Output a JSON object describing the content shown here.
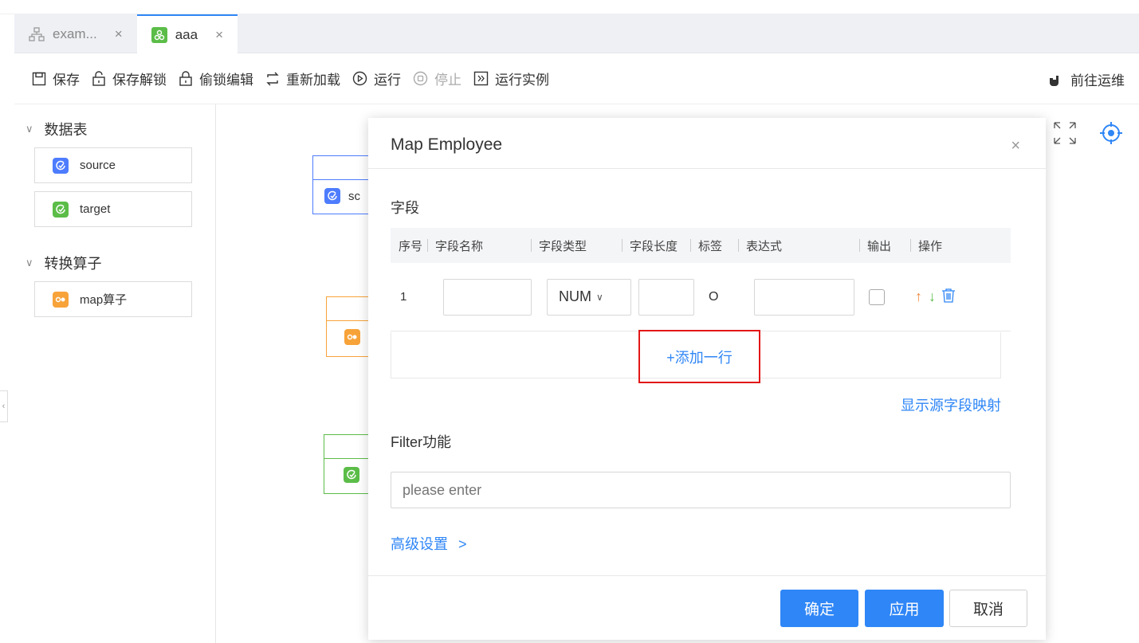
{
  "tabs": [
    {
      "label": "exam...",
      "close": "×",
      "active": false
    },
    {
      "label": "aaa",
      "close": "×",
      "active": true
    }
  ],
  "toolbar": {
    "save": "保存",
    "save_unlock": "保存解锁",
    "steal_lock_edit": "偷锁编辑",
    "reload": "重新加载",
    "run": "运行",
    "stop": "停止",
    "run_instance": "运行实例",
    "goto_ops": "前往运维"
  },
  "sidebar": {
    "section_tables": "数据表",
    "tables": [
      {
        "label": "source",
        "icon": "source-node-icon",
        "color": "#4d7cfe"
      },
      {
        "label": "target",
        "icon": "target-node-icon",
        "color": "#5bbd48"
      }
    ],
    "section_operators": "转换算子",
    "operators": [
      {
        "label": "map算子",
        "icon": "map-operator-icon",
        "color": "#f7a33a"
      }
    ]
  },
  "canvas": {
    "source_node_label": "sc"
  },
  "dialog": {
    "title": "Map Employee",
    "close": "×",
    "fields_label": "字段",
    "columns": [
      "序号",
      "字段名称",
      "字段类型",
      "字段长度",
      "标签",
      "表达式",
      "输出",
      "操作"
    ],
    "rows": [
      {
        "index": "1",
        "field_name": "",
        "field_type": "NUM",
        "field_length": "",
        "tag": "O",
        "expression": "",
        "output": false
      }
    ],
    "add_row": "+添加一行",
    "show_source_mapping": "显示源字段映射",
    "filter_label": "Filter功能",
    "filter_placeholder": "please enter",
    "advanced_settings": "高级设置",
    "advanced_arrow": ">",
    "confirm": "确定",
    "apply": "应用",
    "cancel": "取消"
  },
  "colors": {
    "accent": "#2f86f6",
    "highlight_box": "#e21717",
    "up_arrow": "#f08a3e",
    "down_arrow": "#5bbd48"
  }
}
